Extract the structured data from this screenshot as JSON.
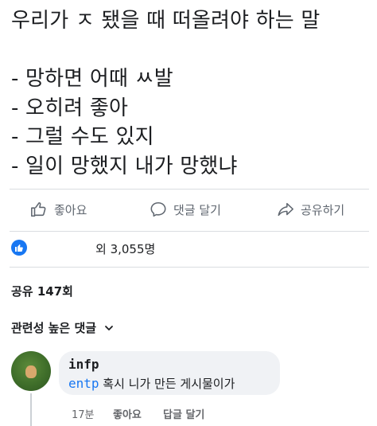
{
  "post": {
    "lines": [
      "우리가 ㅈ 됐을 때 떠올려야 하는 말",
      "",
      "- 망하면 어때 ㅆ발",
      "- 오히려 좋아",
      "- 그럴 수도 있지",
      "- 일이 망했지 내가 망했냐"
    ]
  },
  "actions": {
    "like": {
      "label": "좋아요",
      "icon": "thumbs-up-icon"
    },
    "comment": {
      "label": "댓글 달기",
      "icon": "comment-icon"
    },
    "share": {
      "label": "공유하기",
      "icon": "share-icon"
    }
  },
  "reactions": {
    "icon": "like-reaction-icon",
    "count_text": "외 3,055명",
    "color": "#1877f2"
  },
  "shares": {
    "text": "공유 147회"
  },
  "comments_sort": {
    "label": "관련성 높은 댓글",
    "icon": "chevron-down-icon"
  },
  "comment": {
    "author": "infp",
    "mention": "entp",
    "text": " 혹시 니가 만든 게시물이가",
    "time": "17분",
    "like_label": "좋아요",
    "reply_label": "답글 달기"
  },
  "colors": {
    "text": "#1c1e21",
    "secondary": "#606770",
    "link": "#1877f2",
    "bubble": "#f0f2f5"
  }
}
